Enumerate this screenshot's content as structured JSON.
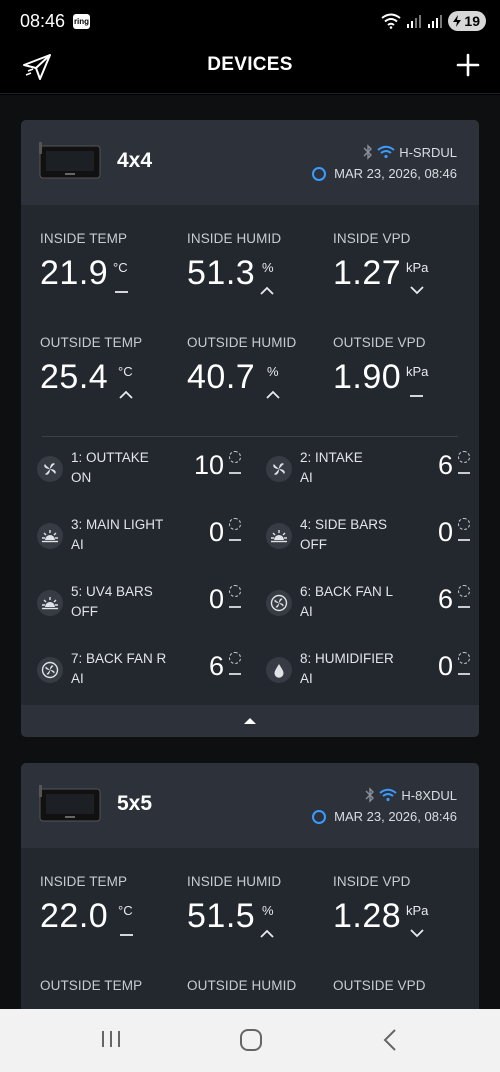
{
  "status": {
    "time": "08:46",
    "ring_badge": "ring",
    "battery": "19"
  },
  "header": {
    "title": "DEVICES"
  },
  "devices": [
    {
      "name": "4x4",
      "bluetooth_id": "H-SRDUL",
      "timestamp": "MAR 23, 2026, 08:46",
      "metrics": {
        "inside_temp": {
          "label": "INSIDE TEMP",
          "value": "21.9",
          "unit": "°C",
          "trend": "flat"
        },
        "inside_humid": {
          "label": "INSIDE HUMID",
          "value": "51.3",
          "unit": "%",
          "trend": "up"
        },
        "inside_vpd": {
          "label": "INSIDE VPD",
          "value": "1.27",
          "unit": "kPa",
          "trend": "down"
        },
        "outside_temp": {
          "label": "OUTSIDE TEMP",
          "value": "25.4",
          "unit": "°C",
          "trend": "up"
        },
        "outside_humid": {
          "label": "OUTSIDE HUMID",
          "value": "40.7",
          "unit": "%",
          "trend": "up"
        },
        "outside_vpd": {
          "label": "OUTSIDE VPD",
          "value": "1.90",
          "unit": "kPa",
          "trend": "flat"
        }
      },
      "ports": [
        {
          "name": "1: OUTTAKE",
          "mode": "ON",
          "level": "10",
          "icon": "fan-icon"
        },
        {
          "name": "2: INTAKE",
          "mode": "AI",
          "level": "6",
          "icon": "fan-icon"
        },
        {
          "name": "3: MAIN LIGHT",
          "mode": "AI",
          "level": "0",
          "icon": "light-icon"
        },
        {
          "name": "4: SIDE BARS",
          "mode": "OFF",
          "level": "0",
          "icon": "light-icon"
        },
        {
          "name": "5: UV4 BARS",
          "mode": "OFF",
          "level": "0",
          "icon": "light-icon"
        },
        {
          "name": "6: BACK FAN L",
          "mode": "AI",
          "level": "6",
          "icon": "clip-fan-icon"
        },
        {
          "name": "7: BACK FAN R",
          "mode": "AI",
          "level": "6",
          "icon": "clip-fan-icon"
        },
        {
          "name": "8: HUMIDIFIER",
          "mode": "AI",
          "level": "0",
          "icon": "droplet-icon"
        }
      ]
    },
    {
      "name": "5x5",
      "bluetooth_id": "H-8XDUL",
      "timestamp": "MAR 23, 2026, 08:46",
      "metrics": {
        "inside_temp": {
          "label": "INSIDE TEMP",
          "value": "22.0",
          "unit": "°C",
          "trend": "flat"
        },
        "inside_humid": {
          "label": "INSIDE HUMID",
          "value": "51.5",
          "unit": "%",
          "trend": "up"
        },
        "inside_vpd": {
          "label": "INSIDE VPD",
          "value": "1.28",
          "unit": "kPa",
          "trend": "down"
        },
        "outside_temp": {
          "label": "OUTSIDE TEMP"
        },
        "outside_humid": {
          "label": "OUTSIDE HUMID"
        },
        "outside_vpd": {
          "label": "OUTSIDE VPD"
        }
      }
    }
  ],
  "colors": {
    "accent_blue": "#3b9bff",
    "card_bg": "#23272e",
    "card_header_bg": "#2c313a",
    "page_bg": "#0e0f11"
  }
}
